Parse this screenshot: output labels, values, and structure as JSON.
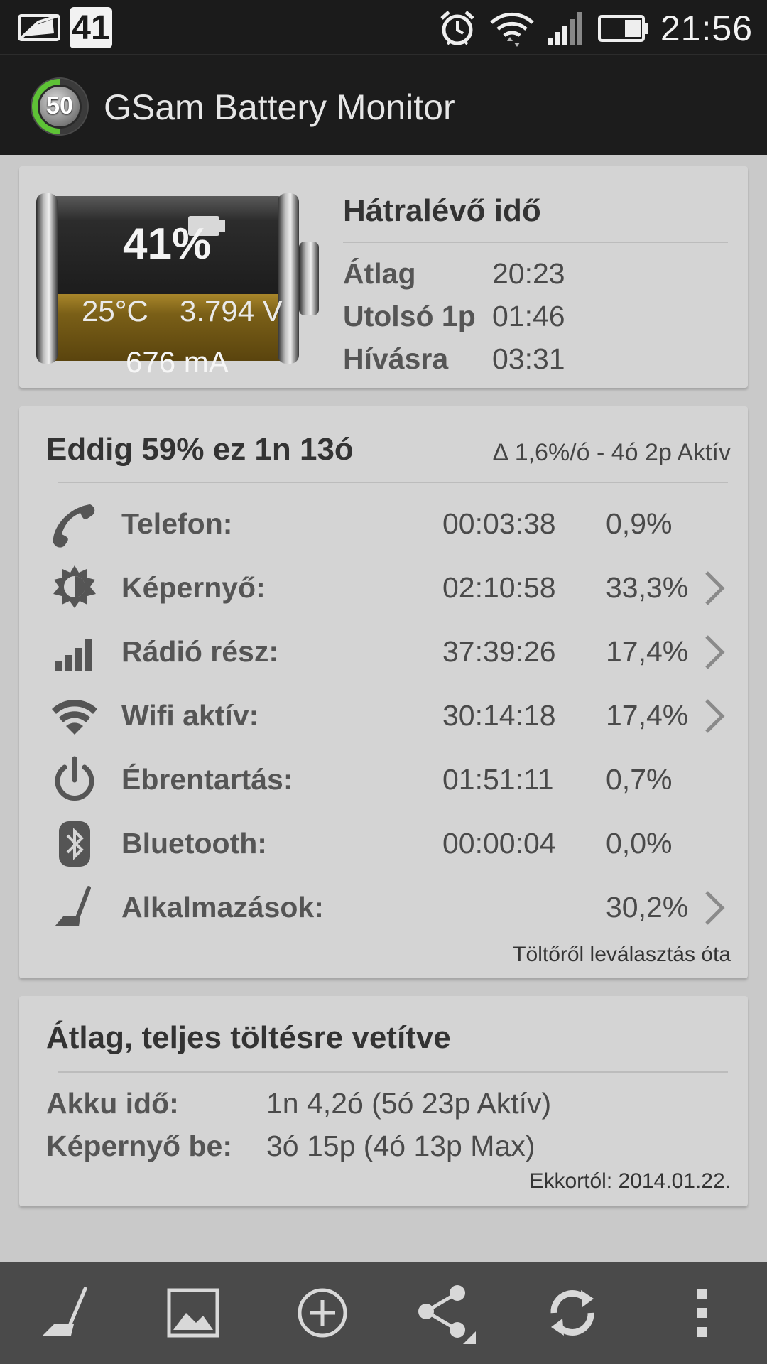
{
  "status_bar": {
    "notification_count": "41",
    "time": "21:56"
  },
  "app": {
    "icon_badge": "50",
    "title": "GSam Battery Monitor"
  },
  "battery": {
    "percent": "41%",
    "temperature": "25°C",
    "voltage": "3.794 V",
    "current": "676 mA",
    "level_fraction": 0.41
  },
  "remaining": {
    "title": "Hátralévő idő",
    "rows": [
      {
        "label": "Átlag",
        "value": "20:23"
      },
      {
        "label": "Utolsó 1p",
        "value": "01:46"
      },
      {
        "label": "Hívásra",
        "value": "03:31"
      }
    ]
  },
  "usage": {
    "title": "Eddig 59% ez 1n 13ó",
    "delta": "∆ 1,6%/ó - 4ó 2p Aktív",
    "rows": [
      {
        "icon": "phone-icon",
        "label": "Telefon:",
        "time": "00:03:38",
        "percent": "0,9%",
        "chevron": false
      },
      {
        "icon": "screen-brightness-icon",
        "label": "Képernyő:",
        "time": "02:10:58",
        "percent": "33,3%",
        "chevron": true
      },
      {
        "icon": "signal-bars-icon",
        "label": "Rádió rész:",
        "time": "37:39:26",
        "percent": "17,4%",
        "chevron": true
      },
      {
        "icon": "wifi-icon",
        "label": "Wifi aktív:",
        "time": "30:14:18",
        "percent": "17,4%",
        "chevron": true
      },
      {
        "icon": "power-icon",
        "label": "Ébrentartás:",
        "time": "01:51:11",
        "percent": "0,7%",
        "chevron": false
      },
      {
        "icon": "bluetooth-icon",
        "label": "Bluetooth:",
        "time": "00:00:04",
        "percent": "0,0%",
        "chevron": false
      },
      {
        "icon": "apps-broom-icon",
        "label": "Alkalmazások:",
        "time": "",
        "percent": "30,2%",
        "chevron": true
      }
    ],
    "footer": "Töltőről leválasztás óta"
  },
  "projection": {
    "title": "Átlag, teljes töltésre vetítve",
    "rows": [
      {
        "label": "Akku idő:",
        "value": "1n 4,2ó (5ó 23p Aktív)"
      },
      {
        "label": "Képernyő be:",
        "value": "3ó 15p (4ó 13p Max)"
      }
    ],
    "footer": "Ekkortól: 2014.01.22."
  },
  "toolbar": {
    "buttons": [
      "apps-broom-icon",
      "image-icon",
      "add-circle-icon",
      "share-icon",
      "refresh-icon",
      "overflow-menu-icon"
    ]
  },
  "colors": {
    "status_bar": "#1b1b1b",
    "action_bar": "#1c1c1c",
    "background": "#c9c9c9",
    "card": "#d4d4d4",
    "toolbar": "#4a4a4a",
    "battery_fill": "#8a6d1c",
    "app_icon_ring": "#5ec236"
  }
}
